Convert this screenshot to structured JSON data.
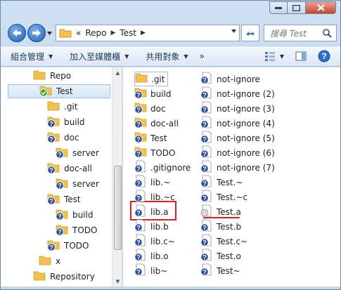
{
  "address": {
    "overflow": "«",
    "crumbs": [
      "Repo",
      "Test"
    ]
  },
  "search": {
    "placeholder": "搜尋 Test"
  },
  "toolbar": {
    "organize": "組合管理",
    "add_library": "加入至媒體櫃",
    "share": "共用對象",
    "more": "»"
  },
  "tree": [
    {
      "label": "Repo",
      "icon": "folder"
    },
    {
      "label": "Test",
      "icon": "folder-check",
      "selected": true
    },
    {
      "label": ".git",
      "icon": "folder"
    },
    {
      "label": "build",
      "icon": "folder-question"
    },
    {
      "label": "doc",
      "icon": "folder-question"
    },
    {
      "label": "server",
      "icon": "folder-question"
    },
    {
      "label": "doc-all",
      "icon": "folder-question"
    },
    {
      "label": "server",
      "icon": "folder-question"
    },
    {
      "label": "Test",
      "icon": "folder-question"
    },
    {
      "label": "build",
      "icon": "folder-question"
    },
    {
      "label": "TODO",
      "icon": "folder-question"
    },
    {
      "label": "TODO",
      "icon": "folder-question"
    },
    {
      "label": "x",
      "icon": "folder"
    },
    {
      "label": "Repository",
      "icon": "folder"
    }
  ],
  "files_col1": [
    {
      "label": ".git",
      "icon": "folder"
    },
    {
      "label": "build",
      "icon": "folder-question"
    },
    {
      "label": "doc",
      "icon": "folder-question"
    },
    {
      "label": "doc-all",
      "icon": "folder-question"
    },
    {
      "label": "Test",
      "icon": "folder-question"
    },
    {
      "label": "TODO",
      "icon": "folder-question"
    },
    {
      "label": ".gitignore",
      "icon": "file-question"
    },
    {
      "label": "lib.~",
      "icon": "file-question"
    },
    {
      "label": "lib.~c",
      "icon": "file-question"
    },
    {
      "label": "lib.a",
      "icon": "file-question"
    },
    {
      "label": "lib.b",
      "icon": "file-question"
    },
    {
      "label": "lib.c~",
      "icon": "file-question"
    },
    {
      "label": "lib.o",
      "icon": "file-question"
    },
    {
      "label": "lib~",
      "icon": "file-question"
    }
  ],
  "files_col2": [
    {
      "label": "not-ignore",
      "icon": "file-question"
    },
    {
      "label": "not-ignore (2)",
      "icon": "file-question"
    },
    {
      "label": "not-ignore (3)",
      "icon": "file-question"
    },
    {
      "label": "not-ignore (4)",
      "icon": "file-question"
    },
    {
      "label": "not-ignore (5)",
      "icon": "file-question"
    },
    {
      "label": "not-ignore (6)",
      "icon": "file-question"
    },
    {
      "label": "not-ignore (7)",
      "icon": "file-question"
    },
    {
      "label": "Test.~",
      "icon": "file-question"
    },
    {
      "label": "Test.~c",
      "icon": "file-question"
    },
    {
      "label": "Test.a",
      "icon": "file-ignored"
    },
    {
      "label": "Test.b",
      "icon": "file-question"
    },
    {
      "label": "Test.c~",
      "icon": "file-question"
    },
    {
      "label": "Test.o",
      "icon": "file-question"
    },
    {
      "label": "Test~",
      "icon": "file-question"
    }
  ],
  "colors": {
    "highlight": "#e0201c",
    "folder": "#f2c24f",
    "question_badge": "#2d4f9e",
    "check_badge": "#3aa53a"
  }
}
